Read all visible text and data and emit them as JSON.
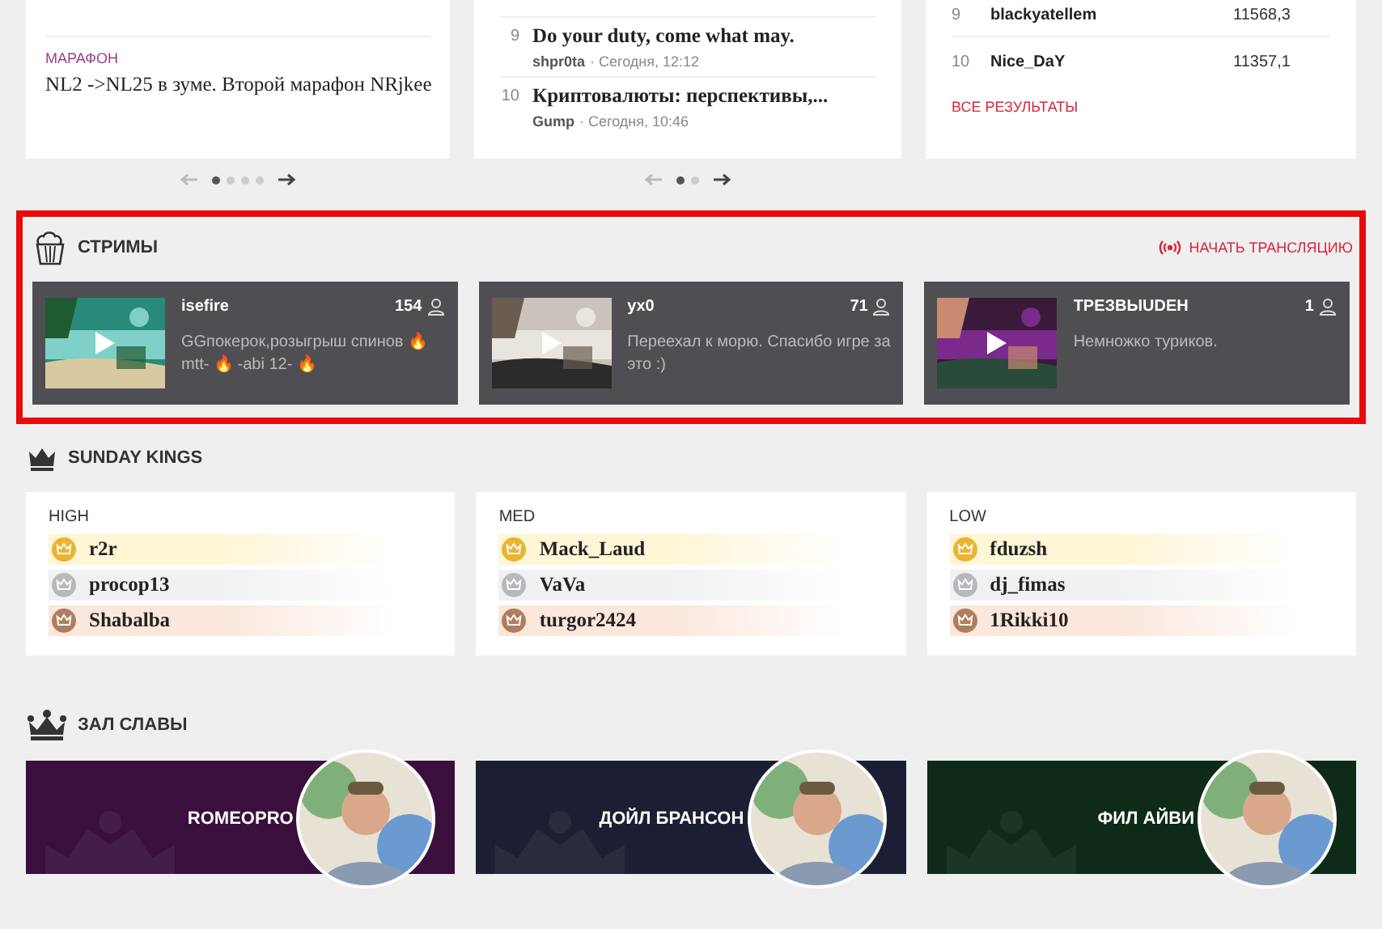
{
  "top_cards": {
    "news": {
      "items": [
        {
          "tag": "МАРАФОН",
          "title": "NL2 ->NL25 в зуме. Второй марафон NRjkee"
        }
      ],
      "pager": [
        {
          "selected": true
        },
        {
          "selected": false
        },
        {
          "selected": false
        },
        {
          "selected": false
        }
      ]
    },
    "forum": {
      "items": [
        {
          "num": "9",
          "title": "Do your duty, come what may.",
          "author": "shpr0ta",
          "time": "· Сегодня, 12:12"
        },
        {
          "num": "10",
          "title": "Криптовалюты: перспективы,...",
          "author": "Gump",
          "time": "· Сегодня, 10:46"
        }
      ],
      "pager": [
        {
          "selected": true
        },
        {
          "selected": false
        }
      ]
    },
    "results": {
      "rows": [
        {
          "num": "9",
          "name": "blackyatellem",
          "score": "11568,3"
        },
        {
          "num": "10",
          "name": "Nice_DaY",
          "score": "11357,1"
        }
      ],
      "link": "ВСЕ РЕЗУЛЬТАТЫ"
    }
  },
  "streams": {
    "title": "СТРИМЫ",
    "action": "НАЧАТЬ ТРАНСЛЯЦИЮ",
    "highlighted": true,
    "items": [
      {
        "name": "isefire",
        "viewers": "154",
        "text": "GGпокерок,розыгрыш спинов 🔥 mtt- 🔥 -abi 12- 🔥"
      },
      {
        "name": "yx0",
        "viewers": "71",
        "text": "Переехал к морю. Спасибо игре за это :)"
      },
      {
        "name": "ТРЕЗВЫUDEH",
        "viewers": "1",
        "text": "Немножко туриков."
      }
    ]
  },
  "sunday_kings": {
    "title": "SUNDAY KINGS",
    "groups": [
      {
        "label": "HIGH",
        "players": [
          {
            "name": "r2r",
            "kind": "gold"
          },
          {
            "name": "procop13",
            "kind": "silver"
          },
          {
            "name": "Shabalba",
            "kind": "bronze"
          }
        ]
      },
      {
        "label": "MED",
        "players": [
          {
            "name": "Mack_Laud",
            "kind": "gold"
          },
          {
            "name": "VaVa",
            "kind": "silver"
          },
          {
            "name": "turgor2424",
            "kind": "bronze"
          }
        ]
      },
      {
        "label": "LOW",
        "players": [
          {
            "name": "fduzsh",
            "kind": "gold"
          },
          {
            "name": "dj_fimas",
            "kind": "silver"
          },
          {
            "name": "1Rikki10",
            "kind": "bronze"
          }
        ]
      }
    ]
  },
  "hall_of_fame": {
    "title": "ЗАЛ СЛАВЫ",
    "items": [
      {
        "name": "ROMEOPRO",
        "color": "#3a0f3e"
      },
      {
        "name": "ДОЙЛ БРАНСОН",
        "color": "#1c1f33"
      },
      {
        "name": "ФИЛ АЙВИ",
        "color": "#0e2a18"
      }
    ]
  }
}
